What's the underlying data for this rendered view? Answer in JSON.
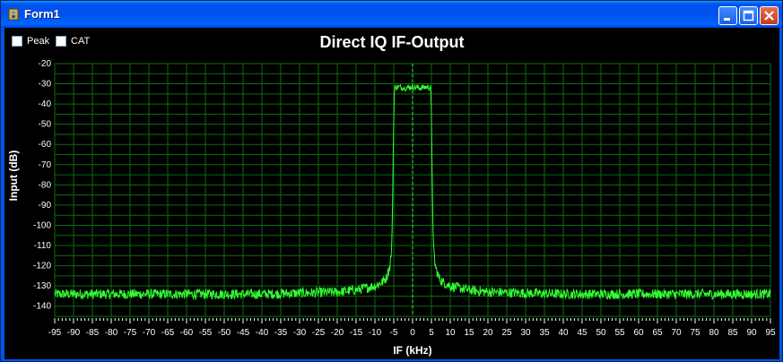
{
  "window": {
    "title": "Form1"
  },
  "controls": {
    "peak_label": "Peak",
    "cat_label": "CAT",
    "peak_checked": false,
    "cat_checked": false
  },
  "colors": {
    "titlebar": "#0054E3",
    "plot_background": "#000000",
    "grid": "#0c6b0c",
    "trace": "#33ff33"
  },
  "chart_data": {
    "type": "line",
    "title": "Direct IQ IF-Output",
    "xlabel": "IF (kHz)",
    "ylabel": "Input (dB)",
    "xlim": [
      -95,
      95
    ],
    "ylim": [
      -145,
      -20
    ],
    "grid": true,
    "x_ticks": [
      -95,
      -90,
      -85,
      -80,
      -75,
      -70,
      -65,
      -60,
      -55,
      -50,
      -45,
      -40,
      -35,
      -30,
      -25,
      -20,
      -15,
      -10,
      -5,
      0,
      5,
      10,
      15,
      20,
      25,
      30,
      35,
      40,
      45,
      50,
      55,
      60,
      65,
      70,
      75,
      80,
      85,
      90,
      95
    ],
    "y_ticks": [
      -20,
      -30,
      -40,
      -50,
      -60,
      -70,
      -80,
      -90,
      -100,
      -110,
      -120,
      -130,
      -140
    ],
    "series": [
      {
        "x": [
          -95,
          -80,
          -60,
          -40,
          -30,
          -20,
          -15,
          -10,
          -8,
          -7,
          -6,
          -5.5,
          -5,
          -4.8,
          -4,
          -2,
          0,
          2,
          4,
          4.8,
          5,
          5.5,
          6,
          7,
          8,
          10,
          15,
          20,
          30,
          40,
          60,
          80,
          95
        ],
        "y": [
          -134,
          -134,
          -134,
          -134,
          -133.5,
          -133,
          -132,
          -130,
          -128,
          -126,
          -120,
          -110,
          -45,
          -32,
          -31.5,
          -32,
          -31.5,
          -32,
          -31.5,
          -32,
          -45,
          -110,
          -120,
          -126,
          -128,
          -130,
          -132,
          -133,
          -133.5,
          -134,
          -134,
          -134,
          -134
        ]
      }
    ],
    "center_marker_x": 0
  }
}
